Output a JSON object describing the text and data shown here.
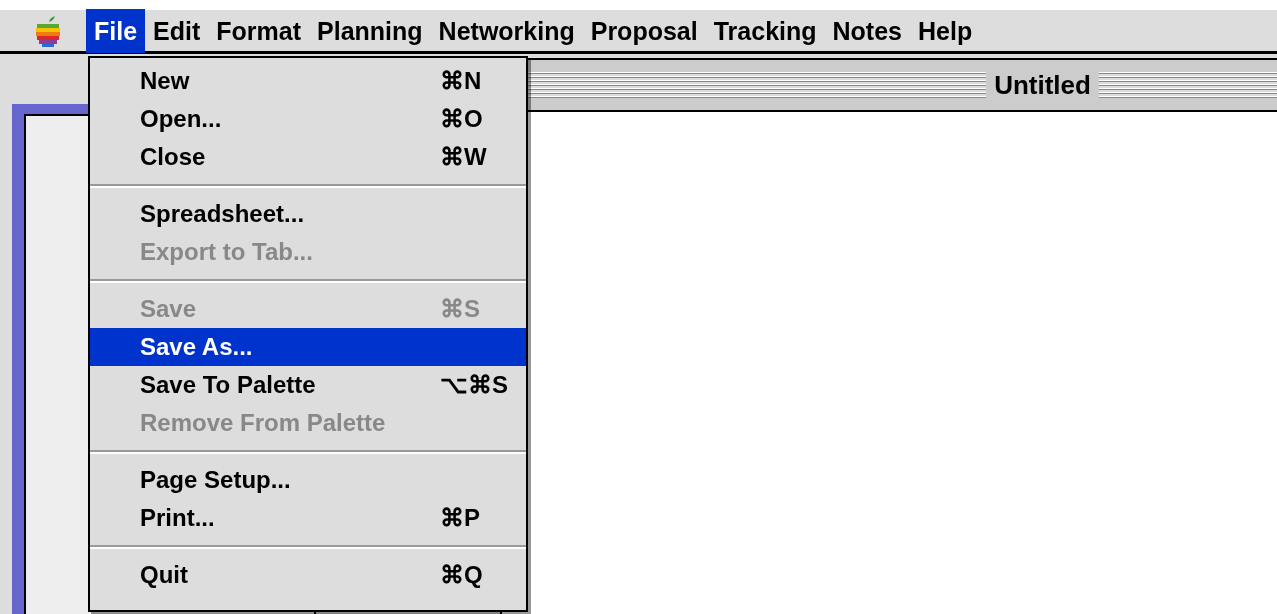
{
  "menubar": {
    "items": [
      {
        "label": "File",
        "selected": true
      },
      {
        "label": "Edit",
        "selected": false
      },
      {
        "label": "Format",
        "selected": false
      },
      {
        "label": "Planning",
        "selected": false
      },
      {
        "label": "Networking",
        "selected": false
      },
      {
        "label": "Proposal",
        "selected": false
      },
      {
        "label": "Tracking",
        "selected": false
      },
      {
        "label": "Notes",
        "selected": false
      },
      {
        "label": "Help",
        "selected": false
      }
    ]
  },
  "file_menu": {
    "groups": [
      [
        {
          "label": "New",
          "shortcut": "⌘N",
          "disabled": false,
          "selected": false
        },
        {
          "label": "Open...",
          "shortcut": "⌘O",
          "disabled": false,
          "selected": false
        },
        {
          "label": "Close",
          "shortcut": "⌘W",
          "disabled": false,
          "selected": false
        }
      ],
      [
        {
          "label": "Spreadsheet...",
          "disabled": false,
          "selected": false
        },
        {
          "label": "Export to Tab...",
          "disabled": true,
          "selected": false
        }
      ],
      [
        {
          "label": "Save",
          "shortcut": "⌘S",
          "disabled": true,
          "selected": false
        },
        {
          "label": "Save As...",
          "disabled": false,
          "selected": true
        },
        {
          "label": "Save To Palette",
          "shortcut": "⌥⌘S",
          "disabled": false,
          "selected": false
        },
        {
          "label": "Remove From Palette",
          "disabled": true,
          "selected": false
        }
      ],
      [
        {
          "label": "Page Setup...",
          "disabled": false,
          "selected": false
        },
        {
          "label": "Print...",
          "shortcut": "⌘P",
          "disabled": false,
          "selected": false
        }
      ],
      [
        {
          "label": "Quit",
          "shortcut": "⌘Q",
          "disabled": false,
          "selected": false
        }
      ]
    ]
  },
  "document_window": {
    "title": "Untitled"
  }
}
